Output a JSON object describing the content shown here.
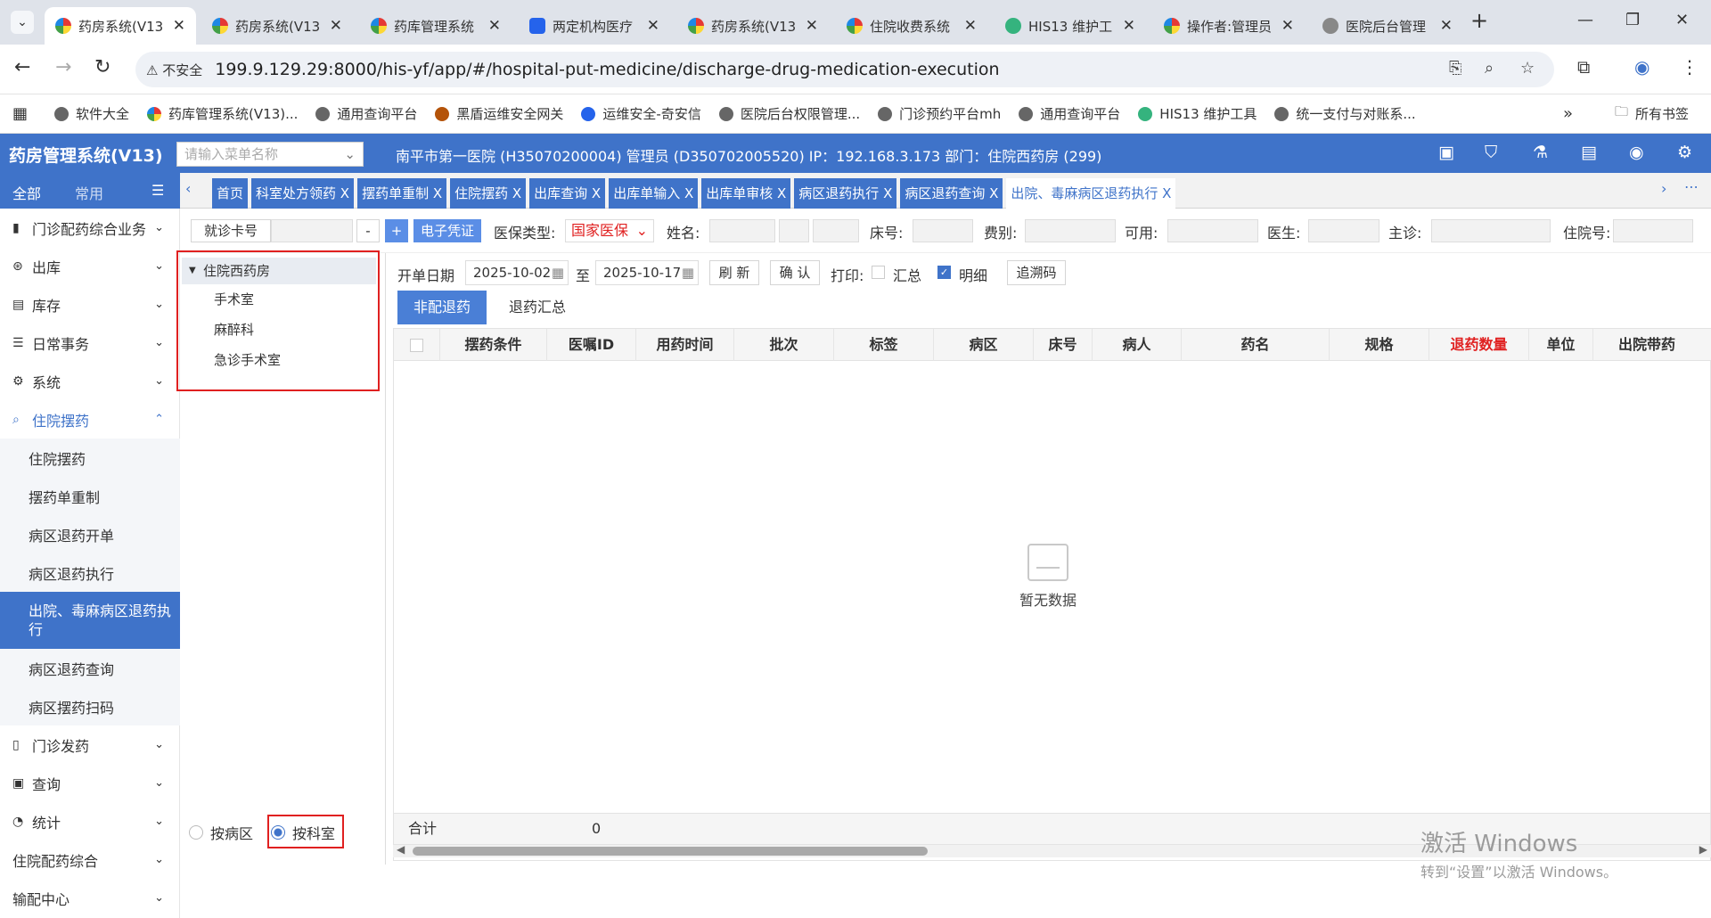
{
  "browser": {
    "tabs": [
      {
        "label": "药房系统(V13",
        "active": true
      },
      {
        "label": "药房系统(V13"
      },
      {
        "label": "药库管理系统"
      },
      {
        "label": "两定机构医疗"
      },
      {
        "label": "药房系统(V13"
      },
      {
        "label": "住院收费系统"
      },
      {
        "label": "HIS13 维护工"
      },
      {
        "label": "操作者:管理员"
      },
      {
        "label": "医院后台管理"
      }
    ],
    "insecure_label": "不安全",
    "url": "199.9.129.29:8000/his-yf/app/#/hospital-put-medicine/discharge-drug-medication-execution",
    "bookmarks": [
      "软件大全",
      "药库管理系统(V13)...",
      "通用查询平台",
      "黑盾运维安全网关",
      "运维安全-奇安信",
      "医院后台权限管理...",
      "门诊预约平台mh",
      "通用查询平台",
      "HIS13 维护工具",
      "统一支付与对账系..."
    ],
    "all_bookmarks": "所有书签"
  },
  "app": {
    "title": "药房管理系统(V13)",
    "menu_search_placeholder": "请输入菜单名称",
    "header_info": "南平市第一医院 (H35070200004) 管理员 (D350702005520) IP：192.168.3.173 部门：住院西药房 (299)"
  },
  "left_tabs": {
    "all": "全部",
    "common": "常用"
  },
  "page_tabs": [
    {
      "label": "首页"
    },
    {
      "label": "科室处方领药 X"
    },
    {
      "label": "摆药单重制 X"
    },
    {
      "label": "住院摆药 X"
    },
    {
      "label": "出库查询 X"
    },
    {
      "label": "出库单输入 X"
    },
    {
      "label": "出库单审核 X"
    },
    {
      "label": "病区退药执行 X"
    },
    {
      "label": "病区退药查询 X"
    },
    {
      "label": "出院、毒麻病区退药执行 X",
      "active": true
    }
  ],
  "sidebar": {
    "items": [
      {
        "label": "门诊配药综合业务"
      },
      {
        "label": "出库"
      },
      {
        "label": "库存"
      },
      {
        "label": "日常事务"
      },
      {
        "label": "系统"
      },
      {
        "label": "住院摆药"
      }
    ],
    "subitems": [
      "住院摆药",
      "摆药单重制",
      "病区退药开单",
      "病区退药执行",
      "出院、毒麻病区退药执行",
      "病区退药查询",
      "病区摆药扫码"
    ],
    "more": [
      "门诊发药",
      "查询",
      "统计",
      "住院配药综合",
      "输配中心"
    ]
  },
  "filters": {
    "card_btn": "就诊卡号",
    "minus": "-",
    "plus": "+",
    "evoucher": "电子凭证",
    "insurance_label": "医保类型:",
    "insurance_value": "国家医保",
    "name_label": "姓名:",
    "bed_label": "床号:",
    "fee_label": "费别:",
    "avail_label": "可用:",
    "doctor_label": "医生:",
    "diag_label": "主诊:",
    "inpatient_label": "住院号:"
  },
  "tree": {
    "root": "住院西药房",
    "children": [
      "手术室",
      "麻醉科",
      "急诊手术室"
    ]
  },
  "radios": {
    "by_ward": "按病区",
    "by_dept": "按科室",
    "selected": "按科室"
  },
  "toolbar": {
    "start_label": "开单日期",
    "start_date": "2025-10-02",
    "to_label": "至",
    "end_date": "2025-10-17",
    "refresh": "刷 新",
    "confirm": "确 认",
    "print_label": "打印:",
    "summary": "汇总",
    "detail": "明细",
    "detail_checked": true,
    "summary_checked": false,
    "trace": "追溯码"
  },
  "subtabs": {
    "active": "非配退药",
    "other": "退药汇总"
  },
  "grid": {
    "columns": [
      "摆药条件",
      "医嘱ID",
      "用药时间",
      "批次",
      "标签",
      "病区",
      "床号",
      "病人",
      "药名",
      "规格",
      "退药数量",
      "单位",
      "出院带药"
    ],
    "empty": "暂无数据",
    "total_label": "合计",
    "total_value": "0"
  },
  "watermark": {
    "line1": "激活 Windows",
    "line2": "转到“设置”以激活 Windows。"
  },
  "colors": {
    "brand": "#3f73c9",
    "highlight_box": "#e02020"
  }
}
